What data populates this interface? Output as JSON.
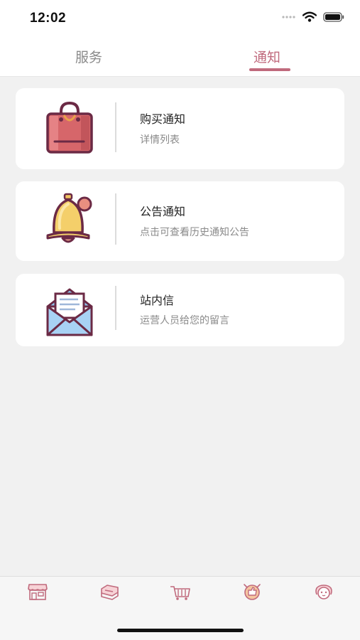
{
  "status_bar": {
    "time": "12:02",
    "icons": [
      "signal-dots-icon",
      "wifi-icon",
      "battery-icon"
    ]
  },
  "tabs": [
    {
      "label": "服务",
      "active": false
    },
    {
      "label": "通知",
      "active": true
    }
  ],
  "colors": {
    "accent": "#c06a7d",
    "background": "#f1f1f1",
    "card": "#ffffff",
    "tab_inactive": "#8a8a8a"
  },
  "notifications": [
    {
      "title": "购买通知",
      "desc": "详情列表",
      "icon": "shopping-bag-icon"
    },
    {
      "title": "公告通知",
      "desc": "点击可查看历史通知公告",
      "icon": "bell-icon"
    },
    {
      "title": "站内信",
      "desc": "运营人员给您的留言",
      "icon": "envelope-icon"
    }
  ],
  "bottom_nav": [
    {
      "icon": "shop-icon"
    },
    {
      "icon": "goods-icon"
    },
    {
      "icon": "cart-icon"
    },
    {
      "icon": "thumbs-up-icon"
    },
    {
      "icon": "profile-icon"
    }
  ]
}
